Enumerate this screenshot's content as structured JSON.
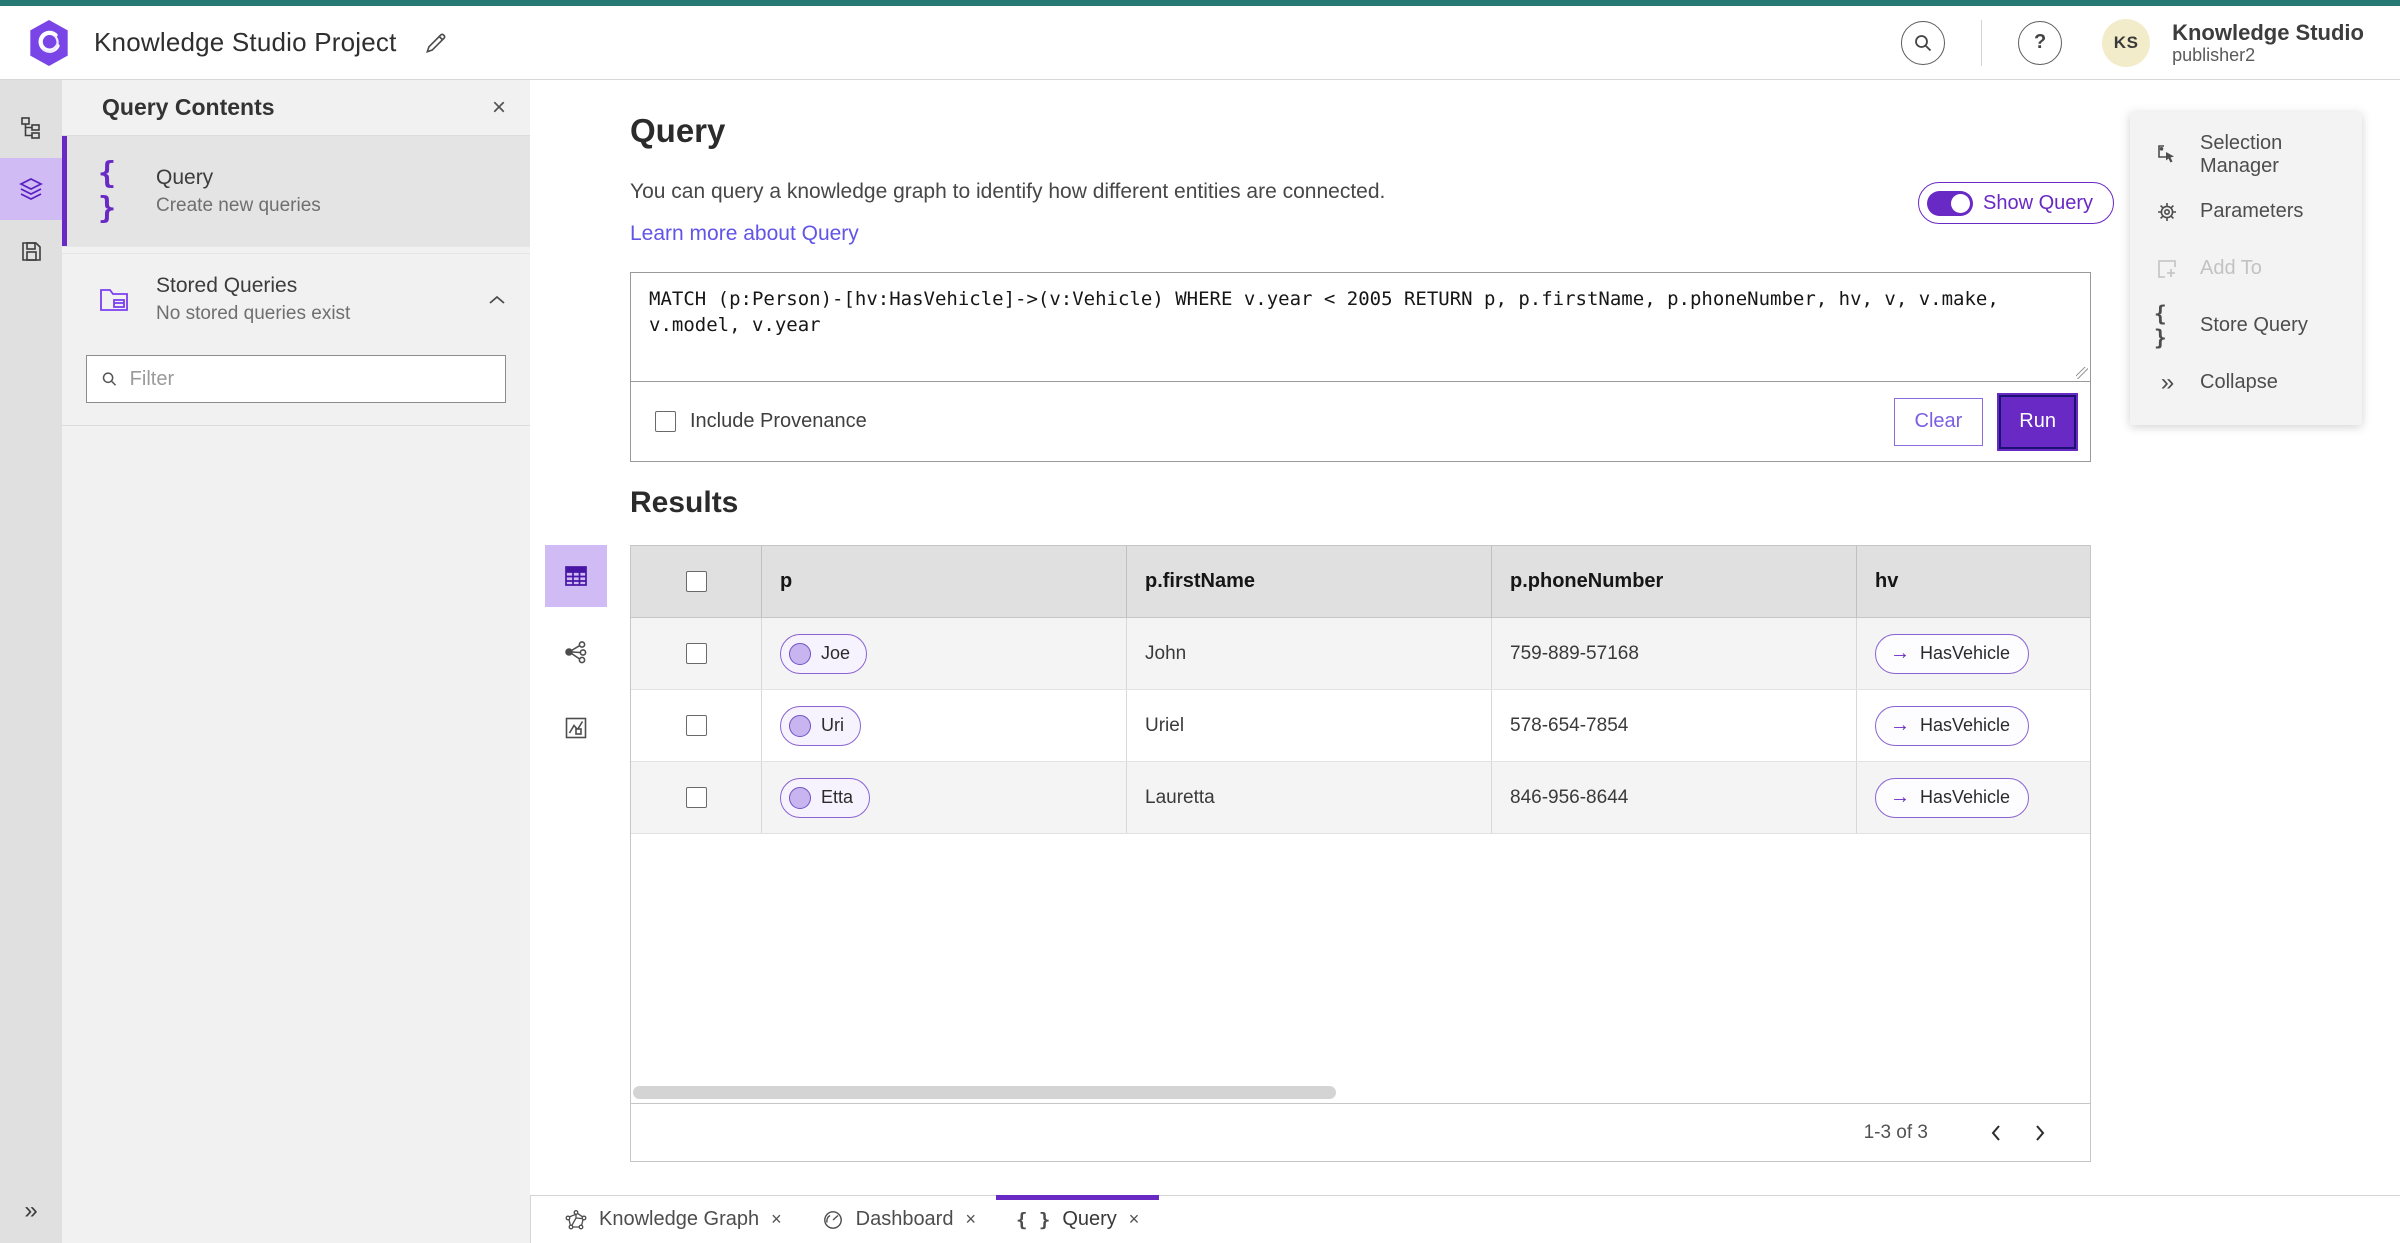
{
  "header": {
    "title": "Knowledge Studio Project",
    "app_name": "Knowledge Studio",
    "user_role": "publisher2",
    "avatar_initials": "KS"
  },
  "panel": {
    "title": "Query Contents",
    "items": [
      {
        "label": "Query",
        "sublabel": "Create new queries"
      },
      {
        "label": "Stored Queries",
        "sublabel": "No stored queries exist"
      }
    ],
    "filter_placeholder": "Filter"
  },
  "query": {
    "heading": "Query",
    "description": "You can query a knowledge graph to identify how different entities are connected.",
    "link_label": "Learn more about Query",
    "show_query_label": "Show Query",
    "text": "MATCH (p:Person)-[hv:HasVehicle]->(v:Vehicle) WHERE v.year < 2005 RETURN p, p.firstName, p.phoneNumber, hv, v, v.make, v.model, v.year",
    "include_provenance_label": "Include Provenance",
    "clear_label": "Clear",
    "run_label": "Run"
  },
  "results": {
    "heading": "Results",
    "columns": [
      "p",
      "p.firstName",
      "p.phoneNumber",
      "hv"
    ],
    "rows": [
      {
        "p": "Joe",
        "firstName": "John",
        "phoneNumber": "759-889-57168",
        "hv": "HasVehicle"
      },
      {
        "p": "Uri",
        "firstName": "Uriel",
        "phoneNumber": "578-654-7854",
        "hv": "HasVehicle"
      },
      {
        "p": "Etta",
        "firstName": "Lauretta",
        "phoneNumber": "846-956-8644",
        "hv": "HasVehicle"
      }
    ],
    "pagination": {
      "range_label": "1-3 of 3"
    }
  },
  "right_panel": {
    "items": [
      {
        "label": "Selection Manager",
        "disabled": false
      },
      {
        "label": "Parameters",
        "disabled": false
      },
      {
        "label": "Add To",
        "disabled": true
      },
      {
        "label": "Store Query",
        "disabled": false
      },
      {
        "label": "Collapse",
        "disabled": false
      }
    ]
  },
  "bottom_tabs": [
    {
      "label": "Knowledge Graph",
      "active": false
    },
    {
      "label": "Dashboard",
      "active": false
    },
    {
      "label": "Query",
      "active": true
    }
  ],
  "colors": {
    "accent": "#6929c4",
    "accent_light": "#d0bbf4",
    "teal_top": "#267a73",
    "link": "#6154e6",
    "avatar_bg": "#f2ecca"
  },
  "icons": {
    "brace": "{ }",
    "collapse": "»",
    "close": "×",
    "help": "?",
    "edge_arrow": "→"
  }
}
